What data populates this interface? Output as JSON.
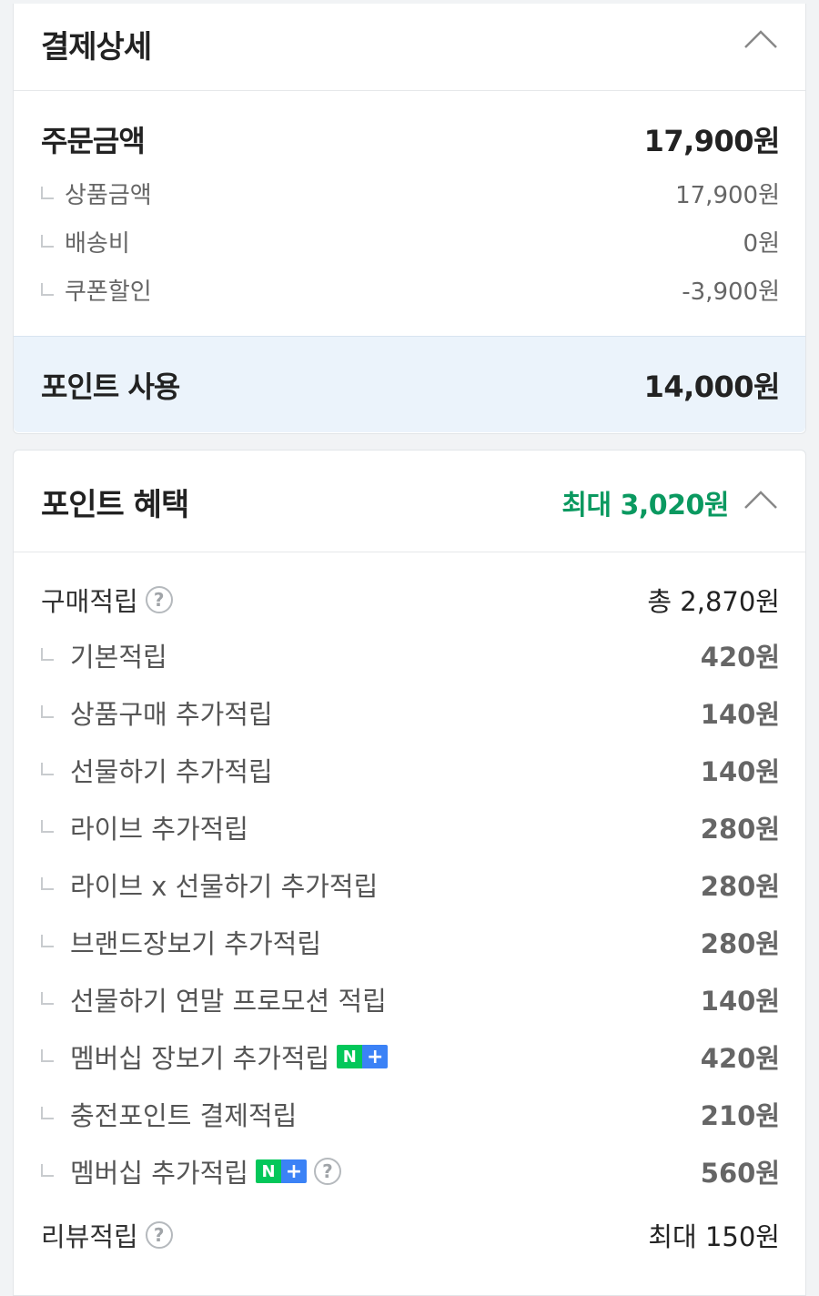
{
  "payment": {
    "title": "결제상세",
    "order": {
      "label": "주문금액",
      "value": "17,900원"
    },
    "details": [
      {
        "label": "상품금액",
        "value": "17,900원"
      },
      {
        "label": "배송비",
        "value": "0원"
      },
      {
        "label": "쿠폰할인",
        "value": "-3,900원"
      }
    ],
    "point_use": {
      "label": "포인트 사용",
      "value": "14,000원"
    }
  },
  "benefits": {
    "title": "포인트 혜택",
    "max_value": "최대 3,020원",
    "purchase": {
      "label": "구매적립",
      "value": "총 2,870원"
    },
    "items": [
      {
        "label": "기본적립",
        "value": "420원"
      },
      {
        "label": "상품구매 추가적립",
        "value": "140원"
      },
      {
        "label": "선물하기 추가적립",
        "value": "140원"
      },
      {
        "label": "라이브 추가적립",
        "value": "280원"
      },
      {
        "label": "라이브 x 선물하기 추가적립",
        "value": "280원"
      },
      {
        "label": "브랜드장보기 추가적립",
        "value": "280원"
      },
      {
        "label": "선물하기 연말 프로모션 적립",
        "value": "140원"
      },
      {
        "label": "멤버십 장보기 추가적립",
        "value": "420원"
      },
      {
        "label": "충전포인트 결제적립",
        "value": "210원"
      },
      {
        "label": "멤버십 추가적립",
        "value": "560원"
      }
    ],
    "review": {
      "label": "리뷰적립",
      "value": "최대 150원"
    }
  },
  "badge": {
    "n": "N",
    "plus": "+",
    "n_color": "#03c75a",
    "plus_color": "#3b82f6"
  },
  "help_glyph": "?",
  "accent_green": "#0a9960"
}
